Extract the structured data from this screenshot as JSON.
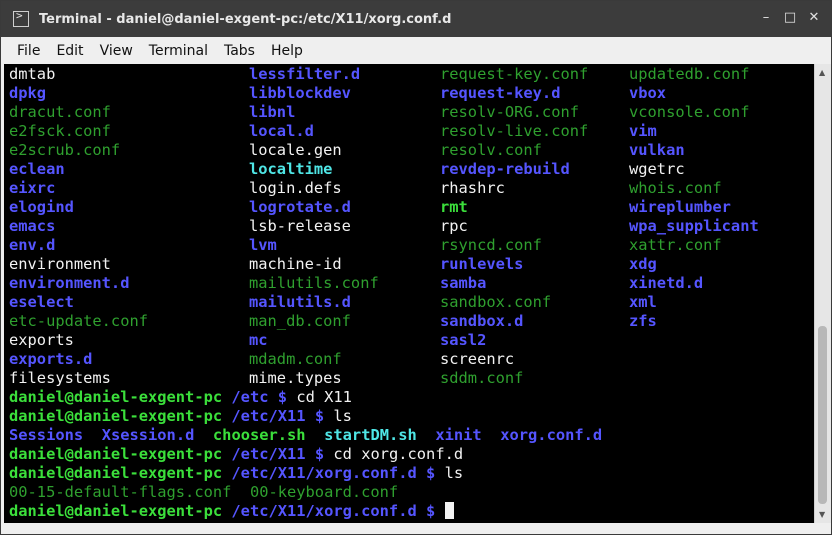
{
  "window": {
    "title": "Terminal - daniel@daniel-exgent-pc:/etc/X11/xorg.conf.d"
  },
  "menu": [
    "File",
    "Edit",
    "View",
    "Terminal",
    "Tabs",
    "Help"
  ],
  "grid": [
    [
      {
        "t": "dmtab",
        "c": "w"
      },
      {
        "t": "lessfilter.d",
        "c": "dir"
      },
      {
        "t": "request-key.conf",
        "c": "g"
      },
      {
        "t": "updatedb.conf",
        "c": "g"
      }
    ],
    [
      {
        "t": "dpkg",
        "c": "dir"
      },
      {
        "t": "libblockdev",
        "c": "dir"
      },
      {
        "t": "request-key.d",
        "c": "dir"
      },
      {
        "t": "vbox",
        "c": "dir"
      }
    ],
    [
      {
        "t": "dracut.conf",
        "c": "g"
      },
      {
        "t": "libnl",
        "c": "dir"
      },
      {
        "t": "resolv-ORG.conf",
        "c": "g"
      },
      {
        "t": "vconsole.conf",
        "c": "g"
      }
    ],
    [
      {
        "t": "e2fsck.conf",
        "c": "g"
      },
      {
        "t": "local.d",
        "c": "dir"
      },
      {
        "t": "resolv-live.conf",
        "c": "g"
      },
      {
        "t": "vim",
        "c": "dir"
      }
    ],
    [
      {
        "t": "e2scrub.conf",
        "c": "g"
      },
      {
        "t": "locale.gen",
        "c": "w"
      },
      {
        "t": "resolv.conf",
        "c": "g"
      },
      {
        "t": "vulkan",
        "c": "dir"
      }
    ],
    [
      {
        "t": "eclean",
        "c": "dir"
      },
      {
        "t": "localtime",
        "c": "cy"
      },
      {
        "t": "revdep-rebuild",
        "c": "dir"
      },
      {
        "t": "wgetrc",
        "c": "w"
      }
    ],
    [
      {
        "t": "eixrc",
        "c": "dir"
      },
      {
        "t": "login.defs",
        "c": "w"
      },
      {
        "t": "rhashrc",
        "c": "w"
      },
      {
        "t": "whois.conf",
        "c": "g"
      }
    ],
    [
      {
        "t": "elogind",
        "c": "dir"
      },
      {
        "t": "logrotate.d",
        "c": "dir"
      },
      {
        "t": "rmt",
        "c": "ex"
      },
      {
        "t": "wireplumber",
        "c": "dir"
      }
    ],
    [
      {
        "t": "emacs",
        "c": "dir"
      },
      {
        "t": "lsb-release",
        "c": "w"
      },
      {
        "t": "rpc",
        "c": "w"
      },
      {
        "t": "wpa_supplicant",
        "c": "dir"
      }
    ],
    [
      {
        "t": "env.d",
        "c": "dir"
      },
      {
        "t": "lvm",
        "c": "dir"
      },
      {
        "t": "rsyncd.conf",
        "c": "g"
      },
      {
        "t": "xattr.conf",
        "c": "g"
      }
    ],
    [
      {
        "t": "environment",
        "c": "w"
      },
      {
        "t": "machine-id",
        "c": "w"
      },
      {
        "t": "runlevels",
        "c": "dir"
      },
      {
        "t": "xdg",
        "c": "dir"
      }
    ],
    [
      {
        "t": "environment.d",
        "c": "dir"
      },
      {
        "t": "mailutils.conf",
        "c": "g"
      },
      {
        "t": "samba",
        "c": "dir"
      },
      {
        "t": "xinetd.d",
        "c": "dir"
      }
    ],
    [
      {
        "t": "eselect",
        "c": "dir"
      },
      {
        "t": "mailutils.d",
        "c": "dir"
      },
      {
        "t": "sandbox.conf",
        "c": "g"
      },
      {
        "t": "xml",
        "c": "dir"
      }
    ],
    [
      {
        "t": "etc-update.conf",
        "c": "g"
      },
      {
        "t": "man_db.conf",
        "c": "g"
      },
      {
        "t": "sandbox.d",
        "c": "dir"
      },
      {
        "t": "zfs",
        "c": "dir"
      }
    ],
    [
      {
        "t": "exports",
        "c": "w"
      },
      {
        "t": "mc",
        "c": "dir"
      },
      {
        "t": "sasl2",
        "c": "dir"
      },
      {
        "t": "",
        "c": "w"
      }
    ],
    [
      {
        "t": "exports.d",
        "c": "dir"
      },
      {
        "t": "mdadm.conf",
        "c": "g"
      },
      {
        "t": "screenrc",
        "c": "w"
      },
      {
        "t": "",
        "c": "w"
      }
    ],
    [
      {
        "t": "filesystems",
        "c": "w"
      },
      {
        "t": "mime.types",
        "c": "w"
      },
      {
        "t": "sddm.conf",
        "c": "g"
      },
      {
        "t": "",
        "c": "w"
      }
    ]
  ],
  "session": {
    "prompt_user": "daniel@daniel-exgent-pc",
    "l1": {
      "path": "/etc",
      "sym": "$",
      "cmd": "cd X11"
    },
    "l2": {
      "path": "/etc/X11",
      "sym": "$",
      "cmd": "ls"
    },
    "x11_ls": [
      {
        "t": "Sessions",
        "c": "dir"
      },
      {
        "t": "Xsession.d",
        "c": "dir"
      },
      {
        "t": "chooser.sh",
        "c": "ex"
      },
      {
        "t": "startDM.sh",
        "c": "cy"
      },
      {
        "t": "xinit",
        "c": "dir"
      },
      {
        "t": "xorg.conf.d",
        "c": "dir"
      }
    ],
    "l3": {
      "path": "/etc/X11",
      "sym": "$",
      "cmd": "cd xorg.conf.d"
    },
    "l4": {
      "path": "/etc/X11/xorg.conf.d",
      "sym": "$",
      "cmd": "ls"
    },
    "conf_ls": [
      {
        "t": "00-15-default-flags.conf",
        "c": "g"
      },
      {
        "t": "00-keyboard.conf",
        "c": "g"
      }
    ],
    "l5": {
      "path": "/etc/X11/xorg.conf.d",
      "sym": "$",
      "cmd": ""
    }
  }
}
